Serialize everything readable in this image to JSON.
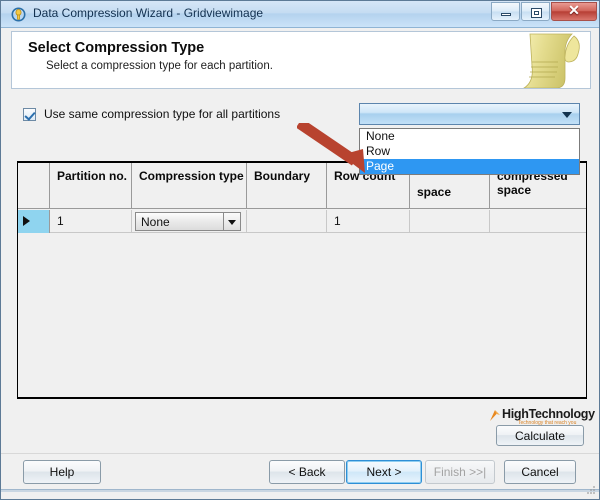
{
  "window": {
    "title": "Data Compression Wizard - Gridviewimage",
    "icon": "database-wizard-icon",
    "controls": {
      "minimize": "minimize-icon",
      "maximize": "maximize-icon",
      "close": "✕"
    }
  },
  "header": {
    "title": "Select Compression Type",
    "subtitle": "Select a compression type for each partition.",
    "icon": "scroll-parchment-icon"
  },
  "options": {
    "use_same_type_label": "Use same compression type for all partitions",
    "use_same_type_checked": true,
    "global_combo_value": "",
    "global_combo_arrow": "chevron-down-icon"
  },
  "dropdown": {
    "open": true,
    "items": [
      "None",
      "Row",
      "Page"
    ],
    "selected": "Page",
    "selected_index": 2,
    "highlight_color": "#2e97f2"
  },
  "annotation": {
    "arrow": "red-pointer-arrow",
    "color": "#b8432f",
    "points_to": "Page"
  },
  "grid": {
    "columns": [
      {
        "header": "",
        "width": 32
      },
      {
        "header": "Partition no.",
        "width": 82
      },
      {
        "header": "Compression type",
        "width": 115
      },
      {
        "header": "Boundary",
        "width": 80
      },
      {
        "header": "Row count",
        "width": 83
      },
      {
        "header": "space",
        "width": 80
      },
      {
        "header": "compressed space",
        "width": 96
      }
    ],
    "rows": [
      {
        "selected": true,
        "row_indicator": "row-select-arrow",
        "partition_no": "1",
        "compression_type": "None",
        "compression_type_arrow": "chevron-down-icon",
        "boundary": "",
        "row_count": "1",
        "space": "",
        "compressed_space": ""
      }
    ]
  },
  "branding": {
    "name": "HighTechnology",
    "tagline": "Technology that reach you",
    "mark": "compass-logo-icon",
    "tagline_color": "#d98326"
  },
  "actions": {
    "calculate": "Calculate",
    "help": "Help",
    "back": "< Back",
    "next": "Next >",
    "finish": "Finish >>|",
    "cancel": "Cancel",
    "next_focused": true,
    "finish_disabled": true
  }
}
